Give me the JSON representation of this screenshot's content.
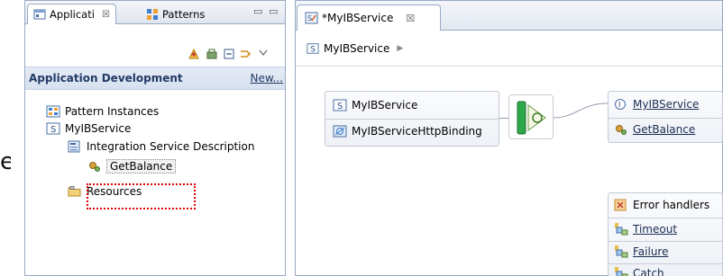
{
  "left_view": {
    "tabs": [
      {
        "label": "Applicati",
        "close": "☒",
        "active": true
      },
      {
        "label": "Patterns",
        "active": false
      }
    ],
    "window_controls": [
      "▭",
      "▭"
    ],
    "section": {
      "title": "Application Development",
      "new_link": "New..."
    },
    "tree": [
      {
        "label": "Pattern Instances",
        "icon": "pattern-instances-icon"
      },
      {
        "label": "MyIBService",
        "icon": "service-icon"
      },
      {
        "label": "Integration Service Description",
        "icon": "service-description-icon"
      },
      {
        "label": "GetBalance",
        "icon": "operation-gear-icon",
        "selected": true
      },
      {
        "label": "Resources",
        "icon": "resources-folder-icon"
      }
    ]
  },
  "cut_text": "e",
  "editor": {
    "tab": {
      "label": "*MyIBService",
      "close": "☒"
    },
    "breadcrumb": {
      "label": "MyIBService"
    },
    "interface_box": {
      "service": "MyIBService",
      "binding": "MyIBServiceHttpBinding"
    },
    "service_box": {
      "interface": "MyIBService",
      "operation": "GetBalance"
    },
    "error_handlers": {
      "title": "Error handlers",
      "items": [
        "Timeout",
        "Failure",
        "Catch"
      ]
    }
  },
  "colors": {
    "highlight_box": "#e00000",
    "section_header": "#d6e0ef",
    "link": "#223a66"
  }
}
